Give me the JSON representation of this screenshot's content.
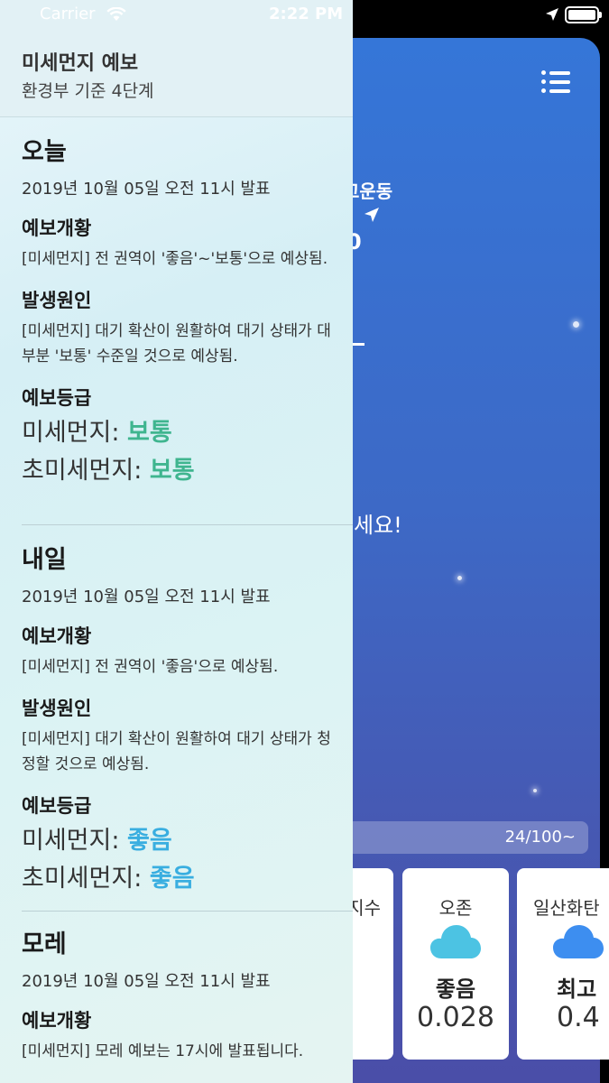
{
  "status_bar": {
    "carrier": "Carrier",
    "time": "2:22 PM"
  },
  "drawer": {
    "title": "미세먼지 예보",
    "subtitle": "환경부 기준 4단계",
    "sections": [
      {
        "heading": "오늘",
        "issued": "2019년 10월 05일 오전 11시 발표",
        "overview_label": "예보개황",
        "overview_text": "[미세먼지] 전 권역이 '좋음'~'보통'으로 예상됨.",
        "cause_label": "발생원인",
        "cause_text": "[미세먼지] 대기 확산이 원활하여 대기 상태가 대부분 '보통' 수준일 것으로 예상됨.",
        "grade_label": "예보등급",
        "pm10_label": "미세먼지: ",
        "pm10_value": "보통",
        "pm25_label": "초미세먼지: ",
        "pm25_value": "보통"
      },
      {
        "heading": "내일",
        "issued": "2019년 10월 05일 오전 11시 발표",
        "overview_label": "예보개황",
        "overview_text": "[미세먼지] 전 권역이 '좋음'으로 예상됨.",
        "cause_label": "발생원인",
        "cause_text": "[미세먼지] 대기 확산이 원활하여 대기 상태가 청정할 것으로 예상됨.",
        "grade_label": "예보등급",
        "pm10_label": "미세먼지: ",
        "pm10_value": "좋음",
        "pm25_label": "초미세먼지: ",
        "pm25_value": "좋음"
      },
      {
        "heading": "모레",
        "issued": "2019년 10월 05일 오전 11시 발표",
        "overview_label": "예보개황",
        "overview_text": "[미세먼지] 모레 예보는 17시에 발표됩니다."
      }
    ]
  },
  "main": {
    "location_fragment": "고운동",
    "temp_fragment": "0",
    "message_fragment": "세요!",
    "range_label": "24/100~",
    "cards": [
      {
        "title": "지수"
      },
      {
        "title": "오존",
        "status": "좋음",
        "value": "0.028"
      },
      {
        "title": "일산화탄",
        "status": "최고",
        "value": "0.4"
      }
    ]
  },
  "colors": {
    "normal": "#3fb58f",
    "good": "#39aee0",
    "cloud_ozone": "#4cc3e3",
    "cloud_co": "#3d8ef0",
    "bg_top": "#3576d8",
    "bg_bottom": "#4a4ea8"
  },
  "icons": [
    "wifi-icon",
    "location-arrow-icon",
    "menu-list-icon",
    "cloud-icon"
  ]
}
